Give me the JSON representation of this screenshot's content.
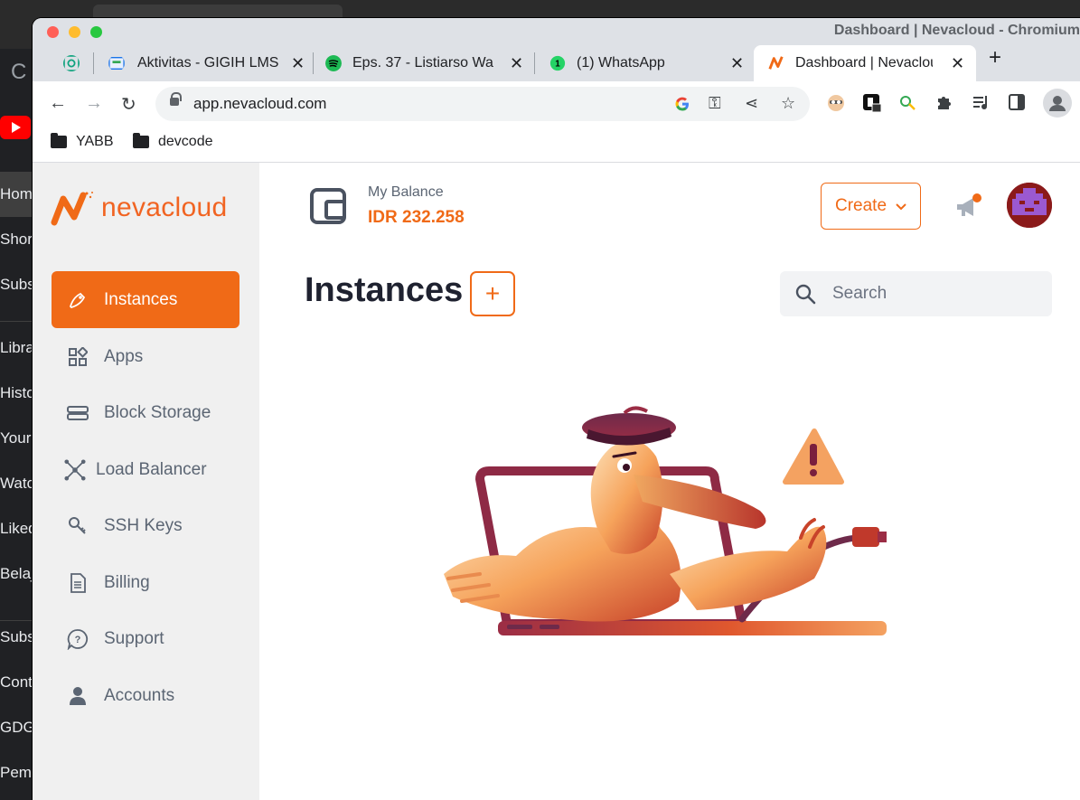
{
  "background_window": {
    "sidebar_items": [
      "Home",
      "Shorts",
      "Subscriptions",
      "Library",
      "History",
      "Your videos",
      "Watch later",
      "Liked videos",
      "Belajar",
      "Subscriptions",
      "Contact",
      "GDG",
      "Pem"
    ]
  },
  "window": {
    "title": "Dashboard | Nevacloud - Chromium"
  },
  "tabs": [
    {
      "label": "",
      "icon": "chatgpt-icon"
    },
    {
      "label": "Aktivitas - GIGIH LMS",
      "icon": "gigih-icon"
    },
    {
      "label": "Eps. 37 - Listiarso Wa",
      "icon": "spotify-icon"
    },
    {
      "label": "(1) WhatsApp",
      "icon": "whatsapp-icon"
    },
    {
      "label": "Dashboard | Nevacloud",
      "icon": "nevacloud-icon",
      "active": true
    }
  ],
  "toolbar": {
    "url": "app.nevacloud.com"
  },
  "bookmarks": [
    {
      "label": "YABB"
    },
    {
      "label": "devcode"
    }
  ],
  "brand": {
    "name": "nevacloud",
    "accent": "#f06a17"
  },
  "sidebar": {
    "items": [
      {
        "label": "Instances",
        "icon": "instances-icon",
        "active": true
      },
      {
        "label": "Apps",
        "icon": "apps-icon"
      },
      {
        "label": "Block Storage",
        "icon": "block-storage-icon"
      },
      {
        "label": "Load Balancer",
        "icon": "load-balancer-icon"
      },
      {
        "label": "SSH Keys",
        "icon": "key-icon"
      },
      {
        "label": "Billing",
        "icon": "billing-icon"
      },
      {
        "label": "Support",
        "icon": "support-icon"
      },
      {
        "label": "Accounts",
        "icon": "account-icon"
      }
    ]
  },
  "header": {
    "balance_label": "My Balance",
    "balance_value": "IDR 232.258",
    "create_label": "Create"
  },
  "main": {
    "title": "Instances",
    "add_label": "+",
    "search_placeholder": "Search"
  }
}
